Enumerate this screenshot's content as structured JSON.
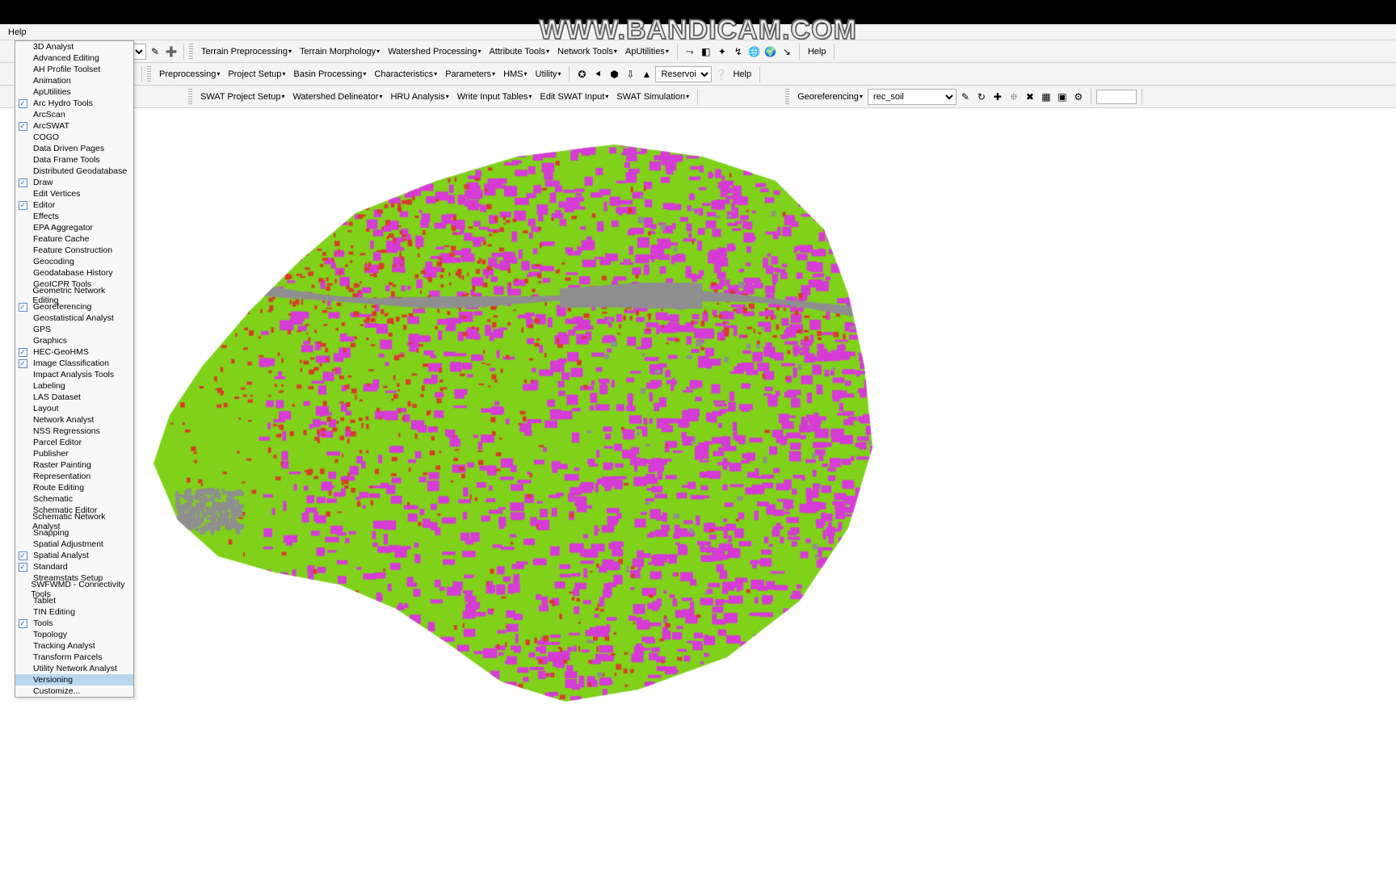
{
  "watermark": "WWW.BANDICAM.COM",
  "menubar": {
    "help": "Help"
  },
  "toolbar1": {
    "terrain_pre": "Terrain Preprocessing",
    "terrain_morph": "Terrain Morphology",
    "watershed_proc": "Watershed Processing",
    "attribute_tools": "Attribute Tools",
    "network_tools": "Network Tools",
    "ap_utilities": "ApUtilities",
    "help": "Help"
  },
  "toolbar2": {
    "preprocessing": "Preprocessing",
    "project_setup": "Project Setup",
    "basin_proc": "Basin Processing",
    "characteristics": "Characteristics",
    "parameters": "Parameters",
    "hms": "HMS",
    "utility": "Utility",
    "reservoir_label": "Reservoir",
    "help": "Help"
  },
  "toolbar3": {
    "swat_project": "SWAT Project Setup",
    "watershed_delin": "Watershed Delineator",
    "hru_analysis": "HRU Analysis",
    "write_input": "Write Input Tables",
    "edit_swat": "Edit SWAT Input",
    "swat_sim": "SWAT Simulation",
    "georef": "Georeferencing",
    "layer_value": "rec_soil"
  },
  "dropdown": {
    "highlighted": "Versioning",
    "items": [
      {
        "label": "3D Analyst",
        "checked": false
      },
      {
        "label": "Advanced Editing",
        "checked": false
      },
      {
        "label": "AH Profile Toolset",
        "checked": false
      },
      {
        "label": "Animation",
        "checked": false
      },
      {
        "label": "ApUtilities",
        "checked": false
      },
      {
        "label": "Arc Hydro Tools",
        "checked": true
      },
      {
        "label": "ArcScan",
        "checked": false
      },
      {
        "label": "ArcSWAT",
        "checked": true
      },
      {
        "label": "COGO",
        "checked": false
      },
      {
        "label": "Data Driven Pages",
        "checked": false
      },
      {
        "label": "Data Frame Tools",
        "checked": false
      },
      {
        "label": "Distributed Geodatabase",
        "checked": false
      },
      {
        "label": "Draw",
        "checked": true
      },
      {
        "label": "Edit Vertices",
        "checked": false
      },
      {
        "label": "Editor",
        "checked": true
      },
      {
        "label": "Effects",
        "checked": false
      },
      {
        "label": "EPA Aggregator",
        "checked": false
      },
      {
        "label": "Feature Cache",
        "checked": false
      },
      {
        "label": "Feature Construction",
        "checked": false
      },
      {
        "label": "Geocoding",
        "checked": false
      },
      {
        "label": "Geodatabase History",
        "checked": false
      },
      {
        "label": "GeoICPR Tools",
        "checked": false
      },
      {
        "label": "Geometric Network Editing",
        "checked": false
      },
      {
        "label": "Georeferencing",
        "checked": true
      },
      {
        "label": "Geostatistical Analyst",
        "checked": false
      },
      {
        "label": "GPS",
        "checked": false
      },
      {
        "label": "Graphics",
        "checked": false
      },
      {
        "label": "HEC-GeoHMS",
        "checked": true
      },
      {
        "label": "Image Classification",
        "checked": true
      },
      {
        "label": "Impact Analysis Tools",
        "checked": false
      },
      {
        "label": "Labeling",
        "checked": false
      },
      {
        "label": "LAS Dataset",
        "checked": false
      },
      {
        "label": "Layout",
        "checked": false
      },
      {
        "label": "Network Analyst",
        "checked": false
      },
      {
        "label": "NSS Regressions",
        "checked": false
      },
      {
        "label": "Parcel Editor",
        "checked": false
      },
      {
        "label": "Publisher",
        "checked": false
      },
      {
        "label": "Raster Painting",
        "checked": false
      },
      {
        "label": "Representation",
        "checked": false
      },
      {
        "label": "Route Editing",
        "checked": false
      },
      {
        "label": "Schematic",
        "checked": false
      },
      {
        "label": "Schematic Editor",
        "checked": false
      },
      {
        "label": "Schematic Network Analyst",
        "checked": false
      },
      {
        "label": "Snapping",
        "checked": false
      },
      {
        "label": "Spatial Adjustment",
        "checked": false
      },
      {
        "label": "Spatial Analyst",
        "checked": true
      },
      {
        "label": "Standard",
        "checked": true
      },
      {
        "label": "Streamstats Setup",
        "checked": false
      },
      {
        "label": "SWFWMD - Connectivity Tools",
        "checked": false
      },
      {
        "label": "Tablet",
        "checked": false
      },
      {
        "label": "TIN Editing",
        "checked": false
      },
      {
        "label": "Tools",
        "checked": true
      },
      {
        "label": "Topology",
        "checked": false
      },
      {
        "label": "Tracking Analyst",
        "checked": false
      },
      {
        "label": "Transform Parcels",
        "checked": false
      },
      {
        "label": "Utility Network Analyst",
        "checked": false
      },
      {
        "label": "Versioning",
        "checked": false
      },
      {
        "label": "Customize...",
        "checked": null
      }
    ]
  },
  "map": {
    "colors": {
      "green": "#7fd11a",
      "magenta": "#d63bd6",
      "red": "#d93c2b",
      "gray": "#8f8f8f"
    }
  }
}
